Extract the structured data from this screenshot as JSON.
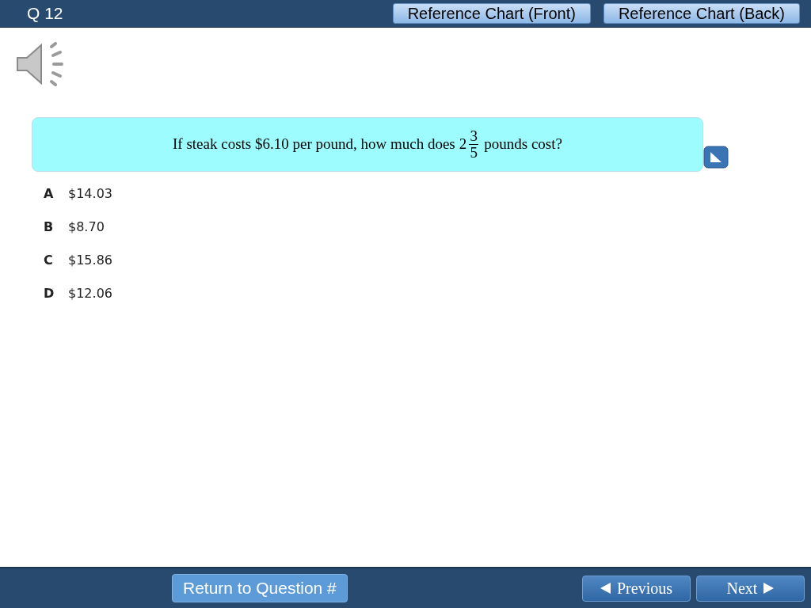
{
  "header": {
    "question_number": "Q 12",
    "buttons": [
      "Reference Chart (Front)",
      "Reference Chart (Back)"
    ]
  },
  "question": {
    "before": "If steak costs $6.10 per pound, how much does",
    "whole": "2",
    "numerator": "3",
    "denominator": "5",
    "after": "pounds cost?"
  },
  "options": [
    {
      "letter": "A",
      "text": "$14.03"
    },
    {
      "letter": "B",
      "text": "$8.70"
    },
    {
      "letter": "C",
      "text": "$15.86"
    },
    {
      "letter": "D",
      "text": "$12.06"
    }
  ],
  "footer": {
    "return_button": "Return to Question #",
    "previous": "Previous",
    "next": "Next"
  }
}
